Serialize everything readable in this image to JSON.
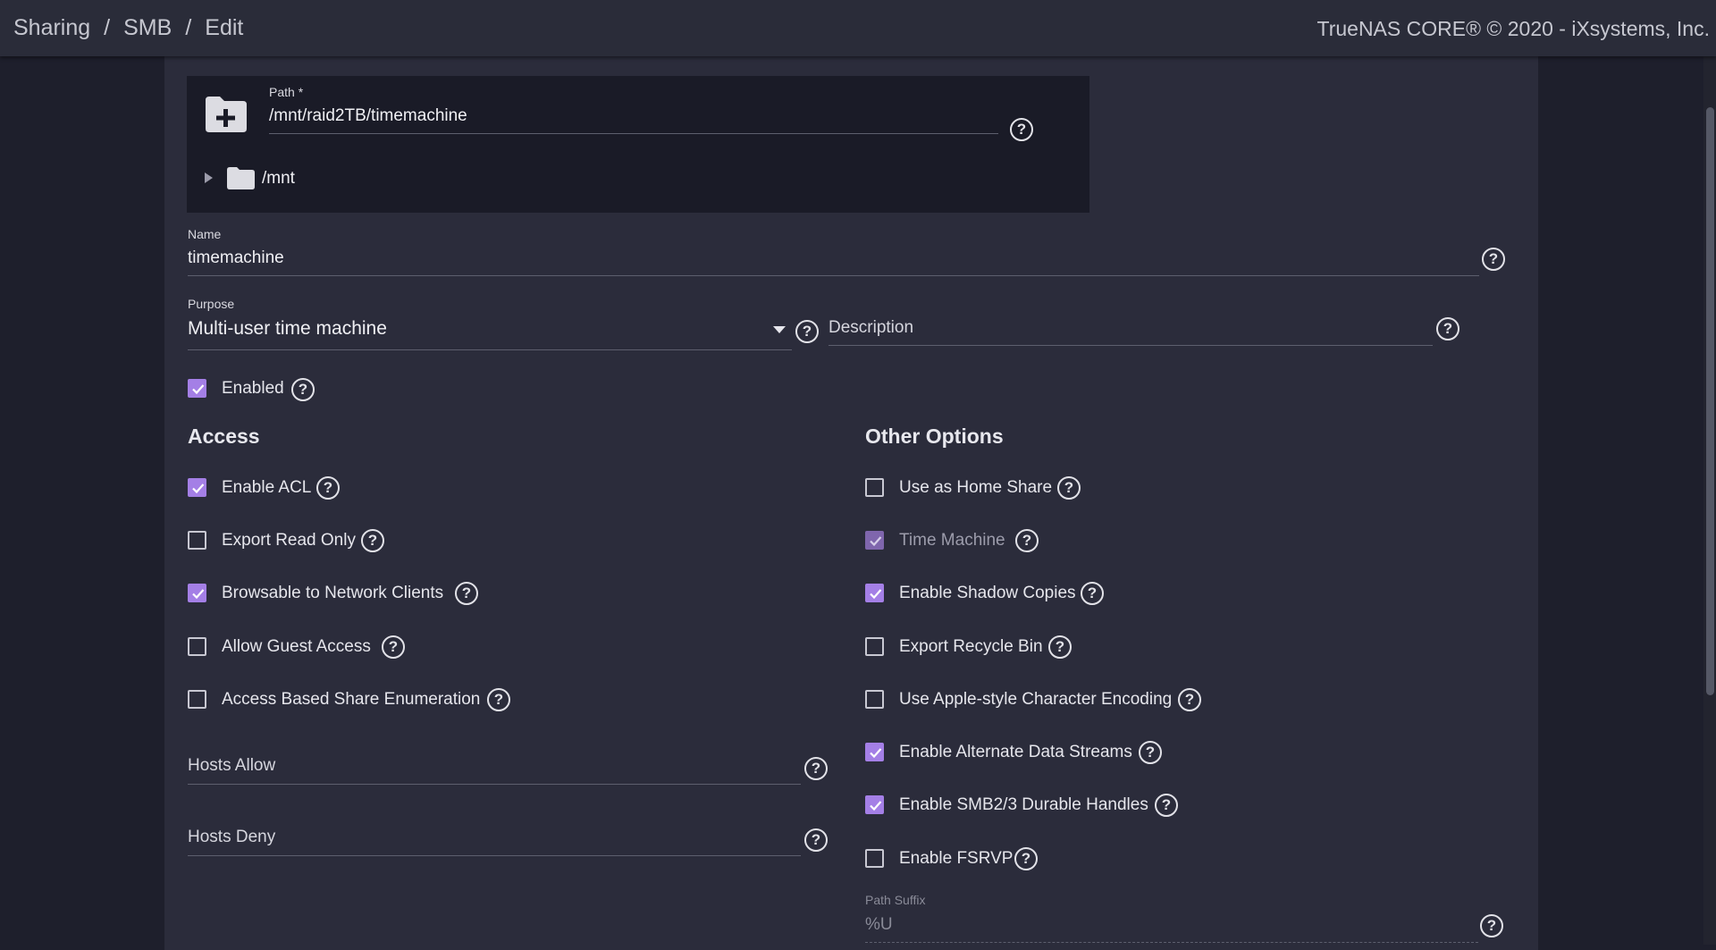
{
  "breadcrumb": {
    "items": [
      "Sharing",
      "SMB",
      "Edit"
    ],
    "separator": "/"
  },
  "copyright": "TrueNAS CORE® © 2020 - iXsystems, Inc.",
  "path": {
    "label": "Path *",
    "value": "/mnt/raid2TB/timemachine",
    "tree_root": "/mnt"
  },
  "name": {
    "label": "Name",
    "value": "timemachine"
  },
  "purpose": {
    "label": "Purpose",
    "value": "Multi-user time machine"
  },
  "description": {
    "placeholder": "Description",
    "value": ""
  },
  "enabled": {
    "label": "Enabled",
    "checked": true
  },
  "access": {
    "title": "Access",
    "options": [
      {
        "label": "Enable ACL",
        "checked": true
      },
      {
        "label": "Export Read Only",
        "checked": false
      },
      {
        "label": "Browsable to Network Clients",
        "checked": true
      },
      {
        "label": "Allow Guest Access",
        "checked": false
      },
      {
        "label": "Access Based Share Enumeration",
        "checked": false
      }
    ],
    "hosts_allow": {
      "placeholder": "Hosts Allow",
      "value": ""
    },
    "hosts_deny": {
      "placeholder": "Hosts Deny",
      "value": ""
    }
  },
  "other": {
    "title": "Other Options",
    "options": [
      {
        "label": "Use as Home Share",
        "checked": false,
        "disabled": false
      },
      {
        "label": "Time Machine",
        "checked": true,
        "disabled": true
      },
      {
        "label": "Enable Shadow Copies",
        "checked": true,
        "disabled": false
      },
      {
        "label": "Export Recycle Bin",
        "checked": false,
        "disabled": false
      },
      {
        "label": "Use Apple-style Character Encoding",
        "checked": false,
        "disabled": false
      },
      {
        "label": "Enable Alternate Data Streams",
        "checked": true,
        "disabled": false
      },
      {
        "label": "Enable SMB2/3 Durable Handles",
        "checked": true,
        "disabled": false
      },
      {
        "label": "Enable FSRVP",
        "checked": false,
        "disabled": false
      }
    ],
    "path_suffix": {
      "label": "Path Suffix",
      "value": "%U"
    }
  },
  "colors": {
    "accent": "#a47fe6",
    "background": "#1e1f2c",
    "card": "#2b2c3b",
    "topbar": "#2a2c39"
  }
}
